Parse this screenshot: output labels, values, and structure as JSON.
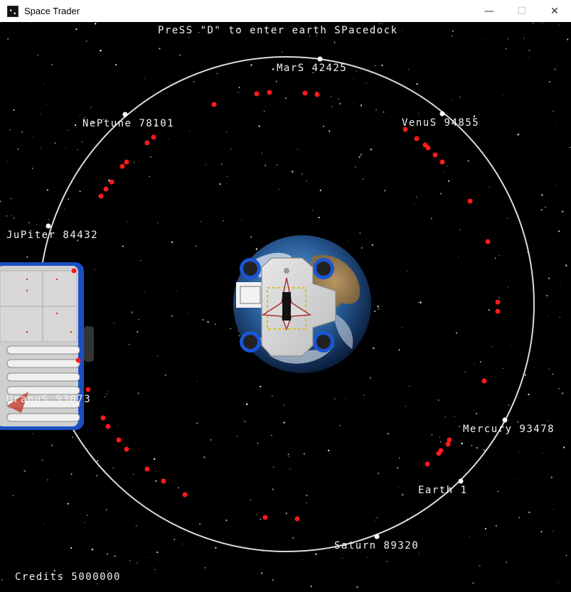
{
  "window": {
    "title": "Space Trader",
    "minimize_glyph": "—",
    "maximize_glyph": "☐",
    "close_glyph": "✕"
  },
  "hud": {
    "prompt": "PreSS \"D\" to enter earth SPacedock",
    "credits": "Credits 5000000"
  },
  "planets": [
    {
      "name": "MarS",
      "value": "42425",
      "label": "MarS 42425"
    },
    {
      "name": "Venus",
      "value": "94855",
      "label": "VenuS 94855"
    },
    {
      "name": "Neptune",
      "value": "78101",
      "label": "NePtune 78101"
    },
    {
      "name": "Jupiter",
      "value": "84432",
      "label": "JuPiter 84432"
    },
    {
      "name": "Uranus",
      "value": "93073",
      "label": "UranuS 93073"
    },
    {
      "name": "Mercury",
      "value": "93478",
      "label": "Mercury 93478"
    },
    {
      "name": "Earth",
      "value": "1",
      "label": "Earth 1"
    },
    {
      "name": "Saturn",
      "value": "89320",
      "label": "Saturn 89320"
    }
  ],
  "colors": {
    "orbit": "#dcdcdc",
    "enemy": "#ff1a1a",
    "ocean": "#2a5f9a",
    "hud_text": "#f2f2f2",
    "station_blue": "#1a4fc4"
  }
}
